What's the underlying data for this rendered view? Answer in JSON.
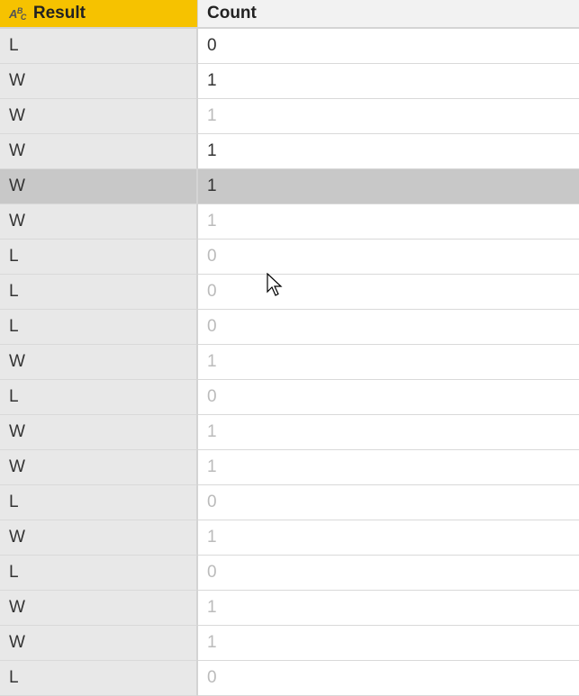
{
  "columns": {
    "result": {
      "label": "Result",
      "type_icon": "ABC"
    },
    "count": {
      "label": "Count"
    }
  },
  "selected_row_index": 4,
  "rows": [
    {
      "result": "L",
      "count": "0",
      "count_dim": false
    },
    {
      "result": "W",
      "count": "1",
      "count_dim": false
    },
    {
      "result": "W",
      "count": "1",
      "count_dim": true
    },
    {
      "result": "W",
      "count": "1",
      "count_dim": false
    },
    {
      "result": "W",
      "count": "1",
      "count_dim": false
    },
    {
      "result": "W",
      "count": "1",
      "count_dim": true
    },
    {
      "result": "L",
      "count": "0",
      "count_dim": true
    },
    {
      "result": "L",
      "count": "0",
      "count_dim": true
    },
    {
      "result": "L",
      "count": "0",
      "count_dim": true
    },
    {
      "result": "W",
      "count": "1",
      "count_dim": true
    },
    {
      "result": "L",
      "count": "0",
      "count_dim": true
    },
    {
      "result": "W",
      "count": "1",
      "count_dim": true
    },
    {
      "result": "W",
      "count": "1",
      "count_dim": true
    },
    {
      "result": "L",
      "count": "0",
      "count_dim": true
    },
    {
      "result": "W",
      "count": "1",
      "count_dim": true
    },
    {
      "result": "L",
      "count": "0",
      "count_dim": true
    },
    {
      "result": "W",
      "count": "1",
      "count_dim": true
    },
    {
      "result": "W",
      "count": "1",
      "count_dim": true
    },
    {
      "result": "L",
      "count": "0",
      "count_dim": true
    }
  ]
}
